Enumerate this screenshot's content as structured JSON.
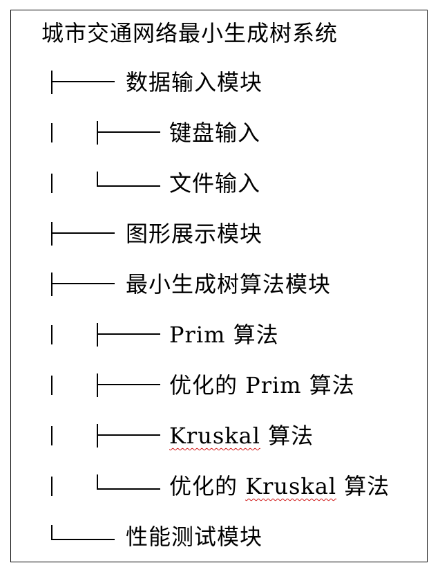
{
  "tree": {
    "root_label": "城市交通网络最小生成树系统",
    "nodes": [
      {
        "label": "数据输入模块",
        "depth": 0,
        "connector": "branch"
      },
      {
        "label": "键盘输入",
        "depth": 1,
        "connector": "branch"
      },
      {
        "label": "文件输入",
        "depth": 1,
        "connector": "last"
      },
      {
        "label": "图形展示模块",
        "depth": 0,
        "connector": "branch"
      },
      {
        "label": "最小生成树算法模块",
        "depth": 0,
        "connector": "branch"
      },
      {
        "label": "Prim 算法",
        "depth": 1,
        "connector": "branch"
      },
      {
        "label": "优化的 Prim 算法",
        "depth": 1,
        "connector": "branch"
      },
      {
        "label": "Kruskal 算法",
        "depth": 1,
        "connector": "branch",
        "spellcheck_word": "Kruskal"
      },
      {
        "label": "优化的 Kruskal 算法",
        "depth": 1,
        "connector": "last",
        "spellcheck_word": "Kruskal"
      },
      {
        "label": "性能测试模块",
        "depth": 0,
        "connector": "last"
      }
    ]
  },
  "colors": {
    "line": "#000000",
    "text": "#000000",
    "spellcheck_underline": "#d01818"
  }
}
